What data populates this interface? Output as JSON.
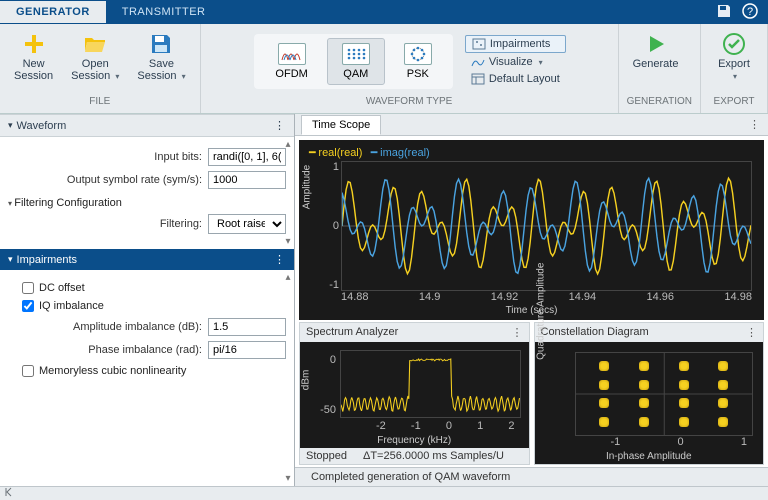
{
  "tabs": {
    "generator": "GENERATOR",
    "transmitter": "TRANSMITTER"
  },
  "ribbon": {
    "file": {
      "label": "FILE",
      "new": "New\nSession",
      "open": "Open\nSession",
      "save": "Save\nSession"
    },
    "waveform": {
      "label": "WAVEFORM TYPE",
      "ofdm": "OFDM",
      "qam": "QAM",
      "psk": "PSK"
    },
    "mid": {
      "impairments": "Impairments",
      "visualize": "Visualize",
      "default_layout": "Default Layout"
    },
    "gen": {
      "label": "GENERATION",
      "generate": "Generate"
    },
    "exp": {
      "label": "EXPORT",
      "export": "Export"
    }
  },
  "panels": {
    "waveform": {
      "title": "Waveform",
      "input_bits_label": "Input bits:",
      "input_bits": "randi([0, 1], 6(",
      "symrate_label": "Output symbol rate (sym/s):",
      "symrate": "1000",
      "filtconf": "Filtering Configuration",
      "filtering_label": "Filtering:",
      "filtering": "Root raised …"
    },
    "impair": {
      "title": "Impairments",
      "dc": "DC offset",
      "iq": "IQ imbalance",
      "amp_label": "Amplitude imbalance (dB):",
      "amp": "1.5",
      "phase_label": "Phase imbalance (rad):",
      "phase": "pi/16",
      "mem": "Memoryless cubic nonlinearity"
    }
  },
  "scope": {
    "tab": "Time Scope",
    "legend_real": "real(real)",
    "legend_imag": "imag(real)",
    "ylabel": "Amplitude",
    "xlabel": "Time (secs)",
    "xticks": [
      "14.88",
      "14.9",
      "14.92",
      "14.94",
      "14.96",
      "14.98"
    ],
    "yticks": [
      "1",
      "0",
      "-1"
    ]
  },
  "spec": {
    "title": "Spectrum Analyzer",
    "ylabel": "dBm",
    "xlabel": "Frequency (kHz)",
    "xticks": [
      "-2",
      "-1",
      "0",
      "1",
      "2"
    ],
    "yticks": [
      "0",
      "-50"
    ],
    "status_left": "Stopped",
    "status_right": "ΔT=256.0000 ms  Samples/U"
  },
  "constel": {
    "title": "Constellation Diagram",
    "ylabel": "Quadrature Amplitude",
    "xlabel": "In-phase Amplitude",
    "xticks": [
      "-1",
      "0",
      "1"
    ]
  },
  "status": "Completed generation of QAM waveform",
  "chart_data": [
    {
      "type": "line",
      "title": "Time Scope",
      "xlabel": "Time (secs)",
      "ylabel": "Amplitude",
      "xlim": [
        14.88,
        14.99
      ],
      "ylim": [
        -1.2,
        1.2
      ],
      "series": [
        {
          "name": "real(real)",
          "color": "#f5d020"
        },
        {
          "name": "imag(real)",
          "color": "#4aa3e0"
        }
      ],
      "note": "dense oscillatory IQ waveform, values approx in [-1,1]"
    },
    {
      "type": "line",
      "title": "Spectrum Analyzer",
      "xlabel": "Frequency (kHz)",
      "ylabel": "dBm",
      "xlim": [
        -2.2,
        2.2
      ],
      "ylim": [
        -70,
        5
      ],
      "series": [
        {
          "name": "spectrum",
          "color": "#f5d020"
        }
      ],
      "note": "flat passband near 0 dBm from approx -0.5 to 0.5 kHz, stopband ripple around -55 dBm"
    },
    {
      "type": "scatter",
      "title": "Constellation Diagram",
      "xlabel": "In-phase Amplitude",
      "ylabel": "Quadrature Amplitude",
      "xlim": [
        -1.5,
        1.5
      ],
      "ylim": [
        -1.5,
        1.5
      ],
      "note": "16-QAM grid, 4x4 clusters at approx ±0.33 and ±1.0 on each axis"
    }
  ]
}
